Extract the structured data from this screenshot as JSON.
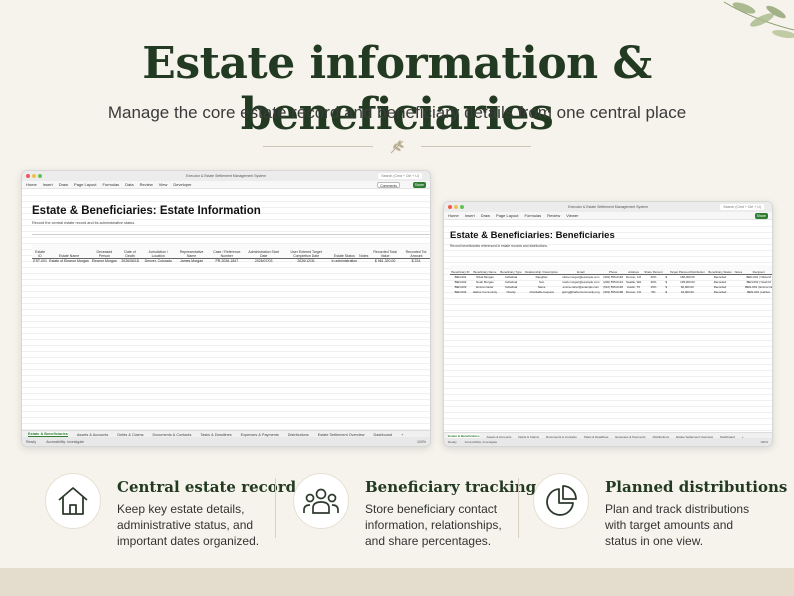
{
  "header": {
    "title": "Estate information & beneficiaries",
    "subtitle": "Manage the core estate record and beneficiary details from one central place"
  },
  "window1": {
    "title": "Executor & Estate Settlement Management System",
    "search": "Search (Cmd + Ctrl + U)",
    "menu": [
      "Home",
      "Insert",
      "Draw",
      "Page Layout",
      "Formulas",
      "Data",
      "Review",
      "View",
      "Developer"
    ],
    "comments": "Comments",
    "share": "Share",
    "sheet_title": "Estate & Beneficiaries: Estate Information",
    "sheet_subtitle": "Record the central estate record and its administrative status.",
    "headers": [
      "Estate ID",
      "Estate Name",
      "Deceased Person",
      "Date of Death",
      "Jurisdiction / Location",
      "Representative Name",
      "Case / Reference Number",
      "Administration Start Date",
      "User Entered Target Completion Date",
      "Estate Status",
      "Notes",
      "Recorded Total Value",
      "Recorded Tot. Amount"
    ],
    "rows": [
      [
        "EST-001",
        "Estate of Eleanor Morgan",
        "Eleanor Morgan",
        "2026/06/18",
        "Denver, Colorado",
        "James Morgan",
        "PR-2026-1847",
        "2026/07/03",
        "2026/12/31",
        "In administration",
        "",
        "$ 961,320.00",
        "$ 224."
      ]
    ],
    "tabs": [
      "Estate & Beneficiaries",
      "Assets & Accounts",
      "Debts & Claims",
      "Documents & Contacts",
      "Tasks & Deadlines",
      "Expenses & Payments",
      "Distributions",
      "Estate Settlement Overview",
      "Dashboard",
      "+"
    ],
    "status": [
      "Ready",
      "Accessibility: Investigate"
    ],
    "zoom": "100%"
  },
  "window2": {
    "title": "Executor & Estate Settlement Management System",
    "search": "Search (Cmd + Ctrl + U)",
    "menu": [
      "Home",
      "Insert",
      "Draw",
      "Page Layout",
      "Formulas",
      "Review",
      "Viewer"
    ],
    "share": "Share",
    "sheet_title": "Estate & Beneficiaries: Beneficiaries",
    "sheet_subtitle": "Record beneficiaries referenced in estate records and distributions.",
    "headers": [
      "Beneficiary ID",
      "Beneficiary Name",
      "Beneficiary Type",
      "Relationship / Description",
      "Email",
      "Phone",
      "Address",
      "Share Percent",
      "",
      "Target Planned Distribution",
      "Beneficiary Status",
      "Notes",
      "Recipient"
    ],
    "rows": [
      [
        "BEN-001",
        "Olivia Morgan",
        "Individual",
        "Daughter",
        "olivia.morgan@example.com",
        "(303) 555-0148",
        "Denver, CO",
        "40%",
        "$",
        "180,000.00",
        "Recorded",
        "",
        "BEN-001 | Olivia M"
      ],
      [
        "BEN-002",
        "Noah Morgan",
        "Individual",
        "Son",
        "noah.morgan@example.com",
        "(206) 555-0124",
        "Seattle, WA",
        "30%",
        "$",
        "135,000.00",
        "Recorded",
        "",
        "BEN-002 | Noah M"
      ],
      [
        "BEN-003",
        "Emma Carter",
        "Individual",
        "Niece",
        "emma.carter@example.com",
        "(512) 555-0136",
        "Austin, TX",
        "15%",
        "$",
        "60,000.00",
        "Recorded",
        "",
        "BEN-003 | Emma Ca"
      ],
      [
        "BEN-004",
        "Harbor Community",
        "Charity",
        "Charitable bequest",
        "giving@harborcommunity.org",
        "(303) 555-0198",
        "Denver, CO",
        "5%",
        "$",
        "18,000.00",
        "Recorded",
        "",
        "BEN-004 | Harbor"
      ]
    ],
    "tabs": [
      "Estate & Beneficiaries",
      "Assets & Accounts",
      "Debts & Claims",
      "Documents & Contacts",
      "Tasks & Deadlines",
      "Expenses & Payments",
      "Distributions",
      "Estate Settlement Overview",
      "Dashboard",
      "+"
    ],
    "status": [
      "Ready",
      "Accessibility: Investigate"
    ],
    "zoom": "100%"
  },
  "features": [
    {
      "icon": "house-icon",
      "title": "Central estate record",
      "desc": "Keep key estate details, administrative status, and important dates organized."
    },
    {
      "icon": "people-icon",
      "title": "Beneficiary tracking",
      "desc": "Store beneficiary contact information, relationships, and share percentages."
    },
    {
      "icon": "pie-chart-icon",
      "title": "Planned distributions",
      "desc": "Plan and track distributions with target amounts and status in one view."
    }
  ],
  "colors": {
    "accent": "#233a22",
    "share_button": "#2e7d32",
    "background": "#f6f3ec"
  }
}
